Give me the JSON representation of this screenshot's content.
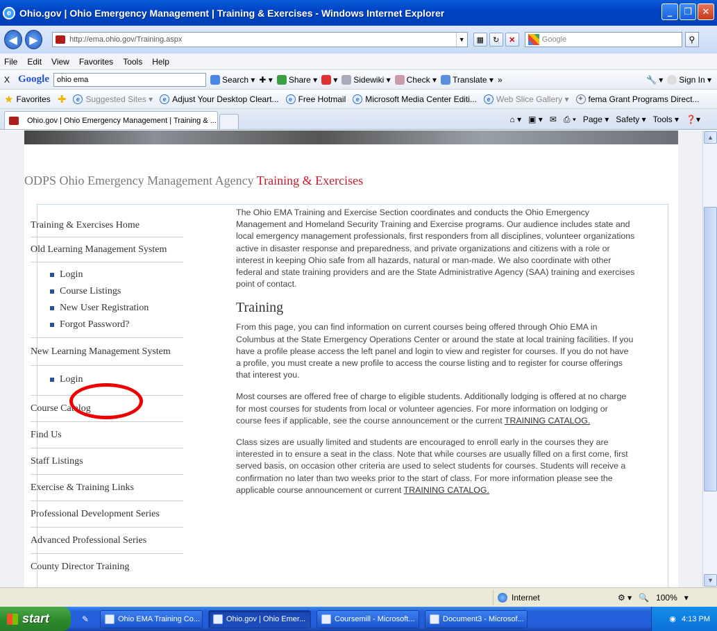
{
  "window": {
    "title": "Ohio.gov | Ohio Emergency Management | Training & Exercises - Windows Internet Explorer",
    "controls": [
      "_",
      "❐",
      "✕"
    ]
  },
  "addressbar": {
    "url": "http://ema.ohio.gov/Training.aspx",
    "search_placeholder": "Google"
  },
  "menubar": [
    "File",
    "Edit",
    "View",
    "Favorites",
    "Tools",
    "Help"
  ],
  "google_toolbar": {
    "close": "X",
    "logo": "Google",
    "query": "ohio ema",
    "buttons": [
      "Search ▾",
      "Share ▾",
      "Sidewiki ▾",
      "Check ▾",
      "Translate ▾",
      "»",
      "Sign In ▾"
    ]
  },
  "favorites_bar": {
    "favorites_label": "Favorites",
    "items": [
      "Suggested Sites ▾",
      "Adjust Your Desktop Cleart...",
      "Free Hotmail",
      "Microsoft Media Center Editi...",
      "Web Slice Gallery ▾",
      "fema Grant Programs Direct..."
    ],
    "overflow": "»"
  },
  "tabbar": {
    "tab_title": "Ohio.gov | Ohio Emergency Management | Training & ...",
    "tools": [
      "Page ▾",
      "Safety ▾",
      "Tools ▾"
    ],
    "overflow": "»"
  },
  "page": {
    "title_prefix": "ODPS Ohio Emergency Management Agency",
    "title_highlight": "Training & Exercises",
    "nav": {
      "home": "Training & Exercises Home",
      "old_lms": "Old Learning Management System",
      "old_lms_items": [
        "Login",
        "Course Listings",
        "New User Registration",
        "Forgot Password?"
      ],
      "new_lms": "New Learning Management System",
      "new_lms_items": [
        "Login"
      ],
      "links": [
        "Course Catalog",
        "Find Us",
        "Staff Listings",
        "Exercise & Training Links",
        "Professional Development Series",
        "Advanced Professional Series",
        "County Director Training"
      ]
    },
    "intro": "The Ohio EMA Training and Exercise Section coordinates and conducts the Ohio Emergency Management and Homeland Security Training and Exercise programs. Our audience includes state and local emergency management professionals, first responders from all disciplines, volunteer organizations active in disaster response and preparedness, and private organizations and citizens with a role or interest in keeping Ohio safe from all hazards, natural or man-made. We also coordinate with other federal and state training providers and are the State Administrative Agency (SAA) training and exercises point of contact.",
    "training_heading": "Training",
    "para1": "From this page, you can find information on current courses being offered through Ohio EMA in Columbus at the State Emergency Operations Center or around the state at local training facilities. If you have a profile please access the left panel and login to view and register for courses. If you do not have a profile, you must create a new profile to access the course listing and to register for course offerings that interest you.",
    "para2_text": "Most courses are offered free of charge to eligible students. Additionally lodging is offered at no charge for most courses for students from local or volunteer agencies. For more information on lodging or course fees if applicable, see the course announcement or the current",
    "para2_link": "TRAINING CATALOG.",
    "para3_text": "Class sizes are usually limited and students are encouraged to enroll early in the courses they are interested in to ensure a seat in the class. Note that while courses are usually filled on a first come, first served basis, on occasion other criteria are used to select students for courses. Students will receive a confirmation no later than two weeks prior to the start of class. For more information please see the applicable course announcement or current",
    "para3_link": "TRAINING CATALOG."
  },
  "statusbar": {
    "zone": "Internet",
    "zoom": "100%"
  },
  "taskbar": {
    "start": "start",
    "tasks": [
      "Ohio EMA Training Co...",
      "Ohio.gov | Ohio Emer...",
      "Coursemill - Microsoft...",
      "Document3 - Microsof..."
    ],
    "clock": "4:13 PM"
  }
}
